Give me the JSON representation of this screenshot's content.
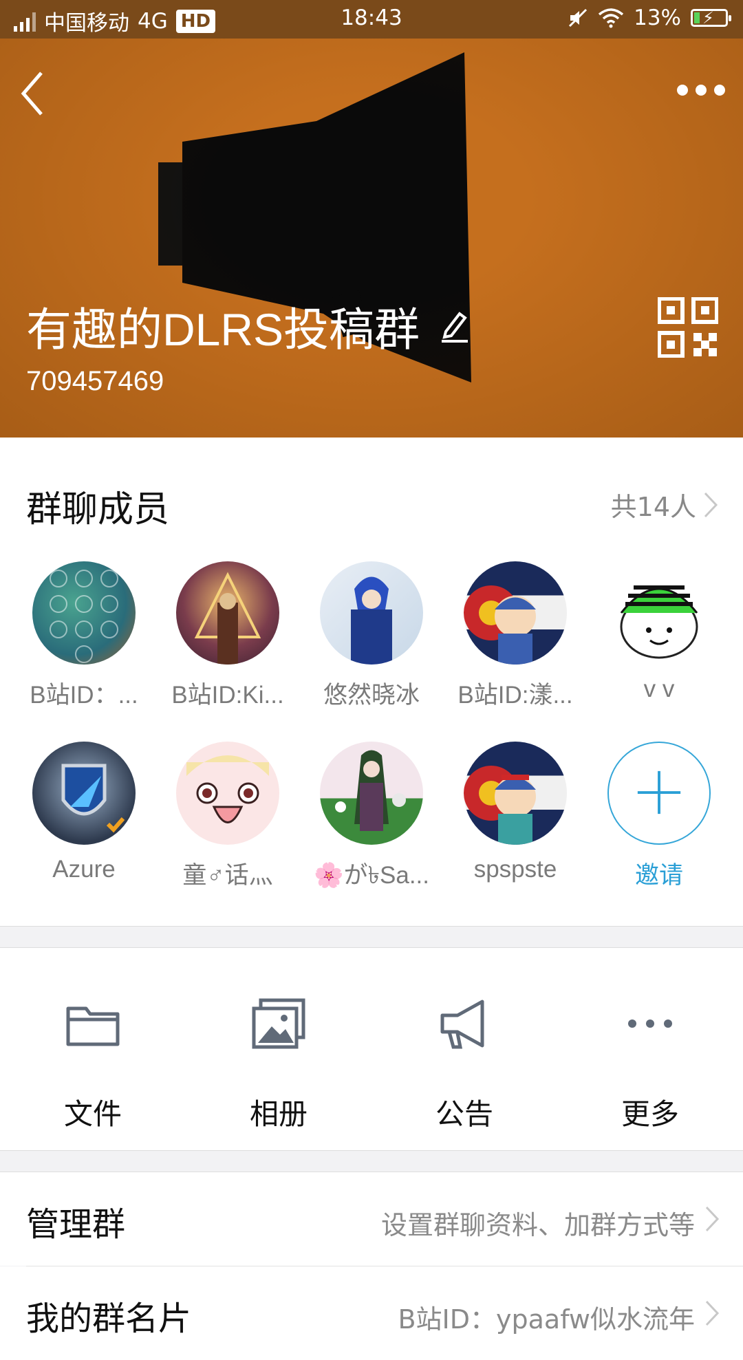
{
  "status_bar": {
    "carrier": "中国移动",
    "network": "4G",
    "hd": "HD",
    "time": "18:43",
    "battery": "13%",
    "battery_level": 0.13
  },
  "header": {
    "title": "有趣的DLRS投稿群",
    "group_id": "709457469",
    "background_color": "#c56f1e"
  },
  "members": {
    "heading": "群聊成员",
    "count": "共14人",
    "list": [
      {
        "name": "B站ID：..."
      },
      {
        "name": "B站ID:Ki..."
      },
      {
        "name": "悠然晓冰"
      },
      {
        "name": "B站ID:漾..."
      },
      {
        "name": "v v"
      },
      {
        "name": "Azure"
      },
      {
        "name": "童♂话灬"
      },
      {
        "name": "🌸が৳Sa..."
      },
      {
        "name": "spspste"
      }
    ],
    "invite_label": "邀请"
  },
  "tools": [
    {
      "label": "文件",
      "icon": "folder-icon"
    },
    {
      "label": "相册",
      "icon": "photo-album-icon"
    },
    {
      "label": "公告",
      "icon": "megaphone-icon"
    },
    {
      "label": "更多",
      "icon": "more-dots-icon"
    }
  ],
  "settings": [
    {
      "label": "管理群",
      "value": "设置群聊资料、加群方式等"
    },
    {
      "label": "我的群名片",
      "value": "B站ID：ypaafw似水流年"
    }
  ],
  "colors": {
    "accent": "#2a9fd6",
    "header": "#c56f1e"
  }
}
